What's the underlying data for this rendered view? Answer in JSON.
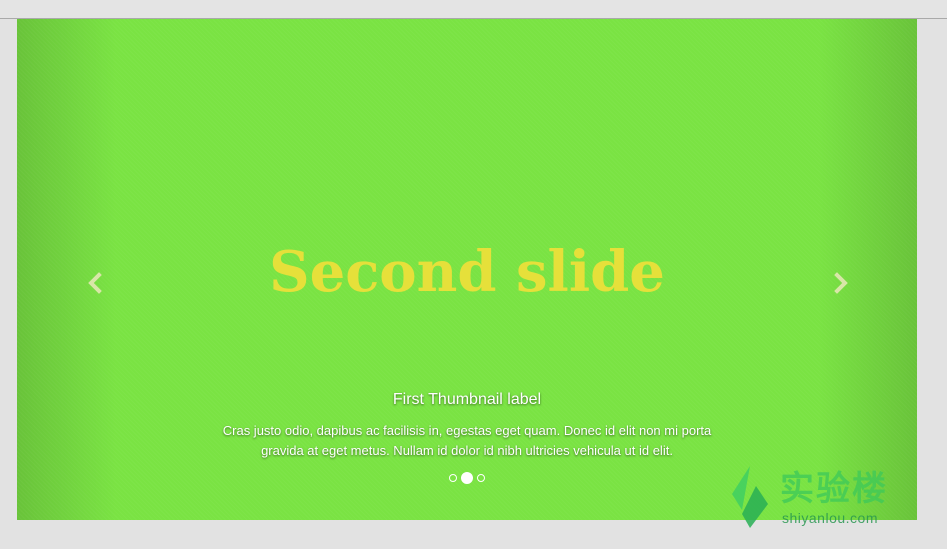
{
  "carousel": {
    "slide_heading": "Second slide",
    "caption_title": "First Thumbnail label",
    "caption_text_line1": "Cras justo odio, dapibus ac facilisis in, egestas eget quam. Donec id elit non mi porta",
    "caption_text_line2": "gravida at eget metus. Nullam id dolor id nibh ultricies vehicula ut id elit.",
    "slide_count": 3,
    "active_index": 1,
    "prev_icon": "chevron-left-icon",
    "next_icon": "chevron-right-icon"
  },
  "watermark": {
    "title_cn": "实验楼",
    "url": "shiyanlou.com"
  },
  "colors": {
    "slide_background": "#7ae343",
    "heading": "#e6e03a",
    "caption": "#ffffff",
    "page_background": "#e2e2e2"
  }
}
